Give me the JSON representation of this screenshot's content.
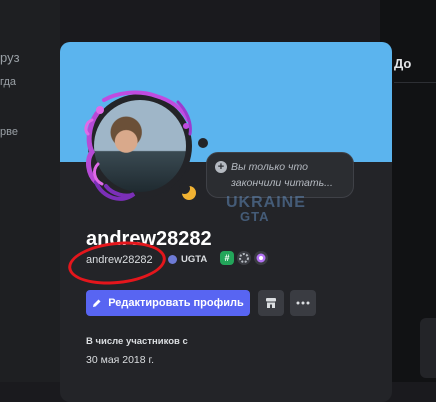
{
  "background": {
    "left_fragments": [
      "руз",
      "гда",
      "рве"
    ],
    "right_tab": "До"
  },
  "popout": {
    "banner_color": "#5bb4ee",
    "status": "idle",
    "custom_status": "Вы только что закончили читать...",
    "watermark": {
      "line1": "UKRAINE",
      "line2": "GTA"
    },
    "display_name": "andrew28282",
    "username": "andrew28282",
    "guild_tag": "UGTA",
    "badges": [
      "hashtag-badge",
      "quest-badge",
      "nitro-badge"
    ],
    "edit_button_label": "Редактировать профиль",
    "member_since_label": "В числе участников с",
    "member_since_date": "30 мая 2018 г.",
    "colors": {
      "accent": "#5865f2",
      "annotation_circle": "#e4161c",
      "idle": "#f0b232"
    }
  }
}
